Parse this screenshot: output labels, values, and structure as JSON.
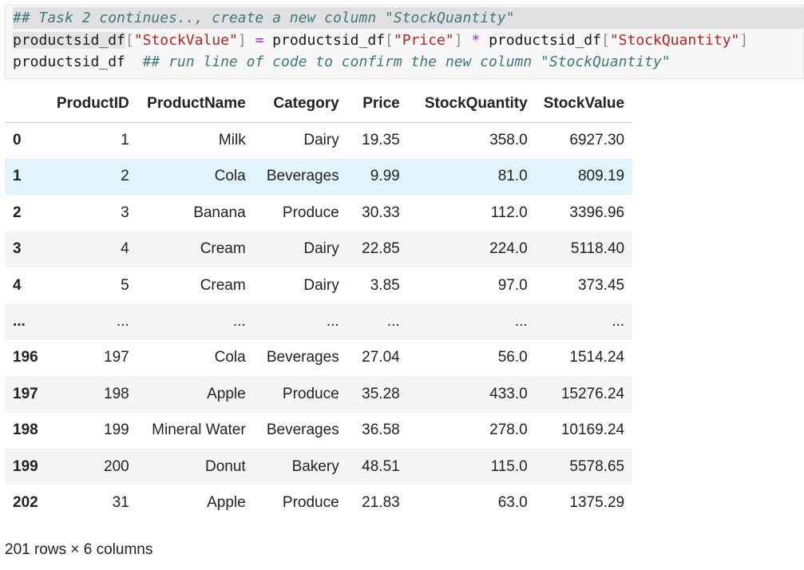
{
  "code_cell": {
    "line1": "## Task 2 continues.., create a new column \"StockQuantity\"",
    "line2": {
      "var1": "productsid_df",
      "br1_open": "[",
      "key1": "\"StockValue\"",
      "br1_close": "]",
      "assign": " = ",
      "var2": "productsid_df",
      "br2_open": "[",
      "key2": "\"Price\"",
      "br2_close": "]",
      "mul": " * ",
      "var3": "productsid_df",
      "br3_open": "[",
      "key3": "\"StockQuantity\"",
      "br3_close": "]"
    },
    "line3": {
      "var": "productsid_df  ",
      "comment": "## run line of code to confirm the new column \"StockQuantity\""
    }
  },
  "dataframe": {
    "columns": [
      "",
      "ProductID",
      "ProductName",
      "Category",
      "Price",
      "StockQuantity",
      "StockValue"
    ],
    "rows": [
      [
        "0",
        "1",
        "Milk",
        "Dairy",
        "19.35",
        "358.0",
        "6927.30"
      ],
      [
        "1",
        "2",
        "Cola",
        "Beverages",
        "9.99",
        "81.0",
        "809.19"
      ],
      [
        "2",
        "3",
        "Banana",
        "Produce",
        "30.33",
        "112.0",
        "3396.96"
      ],
      [
        "3",
        "4",
        "Cream",
        "Dairy",
        "22.85",
        "224.0",
        "5118.40"
      ],
      [
        "4",
        "5",
        "Cream",
        "Dairy",
        "3.85",
        "97.0",
        "373.45"
      ],
      [
        "...",
        "...",
        "...",
        "...",
        "...",
        "...",
        "..."
      ],
      [
        "196",
        "197",
        "Cola",
        "Beverages",
        "27.04",
        "56.0",
        "1514.24"
      ],
      [
        "197",
        "198",
        "Apple",
        "Produce",
        "35.28",
        "433.0",
        "15276.24"
      ],
      [
        "198",
        "199",
        "Mineral Water",
        "Beverages",
        "36.58",
        "278.0",
        "10169.24"
      ],
      [
        "199",
        "200",
        "Donut",
        "Bakery",
        "48.51",
        "115.0",
        "5578.65"
      ],
      [
        "202",
        "31",
        "Apple",
        "Produce",
        "21.83",
        "63.0",
        "1375.29"
      ]
    ],
    "shape_text": "201 rows × 6 columns"
  }
}
